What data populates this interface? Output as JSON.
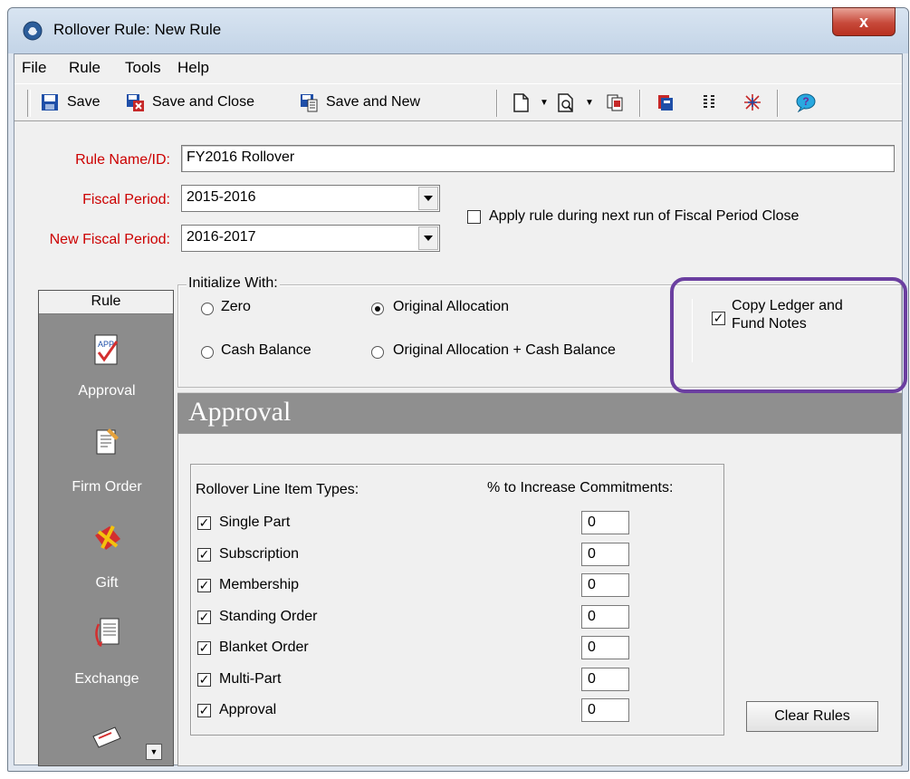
{
  "window": {
    "title": "Rollover Rule: New Rule",
    "close_label": "x"
  },
  "menu": {
    "items": [
      "File",
      "Rule",
      "Tools",
      "Help"
    ]
  },
  "toolbar": {
    "save_label": "Save",
    "save_close_label": "Save and Close",
    "save_new_label": "Save and New"
  },
  "form": {
    "rule_name_label": "Rule Name/ID:",
    "rule_name_value": "FY2016 Rollover",
    "fiscal_period_label": "Fiscal Period:",
    "fiscal_period_value": "2015-2016",
    "new_fiscal_period_label": "New Fiscal Period:",
    "new_fiscal_period_value": "2016-2017",
    "apply_rule_label": "Apply rule during next run of Fiscal Period Close",
    "apply_rule_checked": false
  },
  "initialize": {
    "legend": "Initialize With:",
    "options": [
      "Zero",
      "Original Allocation",
      "Cash Balance",
      "Original Allocation + Cash Balance"
    ],
    "selected": "Original Allocation"
  },
  "copy_notes": {
    "label_line1": "Copy Ledger and",
    "label_line2": "Fund Notes",
    "checked": true
  },
  "sidebar": {
    "header": "Rule",
    "items": [
      "Approval",
      "Firm Order",
      "Gift",
      "Exchange"
    ]
  },
  "approval": {
    "section_title": "Approval",
    "types_header": "Rollover Line Item Types:",
    "percent_header": "% to Increase Commitments:",
    "rows": [
      {
        "label": "Single Part",
        "checked": true,
        "value": "0"
      },
      {
        "label": "Subscription",
        "checked": true,
        "value": "0"
      },
      {
        "label": "Membership",
        "checked": true,
        "value": "0"
      },
      {
        "label": "Standing Order",
        "checked": true,
        "value": "0"
      },
      {
        "label": "Blanket Order",
        "checked": true,
        "value": "0"
      },
      {
        "label": "Multi-Part",
        "checked": true,
        "value": "0"
      },
      {
        "label": "Approval",
        "checked": true,
        "value": "0"
      }
    ],
    "clear_button": "Clear Rules"
  },
  "colors": {
    "label_red": "#cc0000",
    "highlight_purple": "#6b3fa0",
    "sidebar_gray": "#8c8c8c"
  }
}
